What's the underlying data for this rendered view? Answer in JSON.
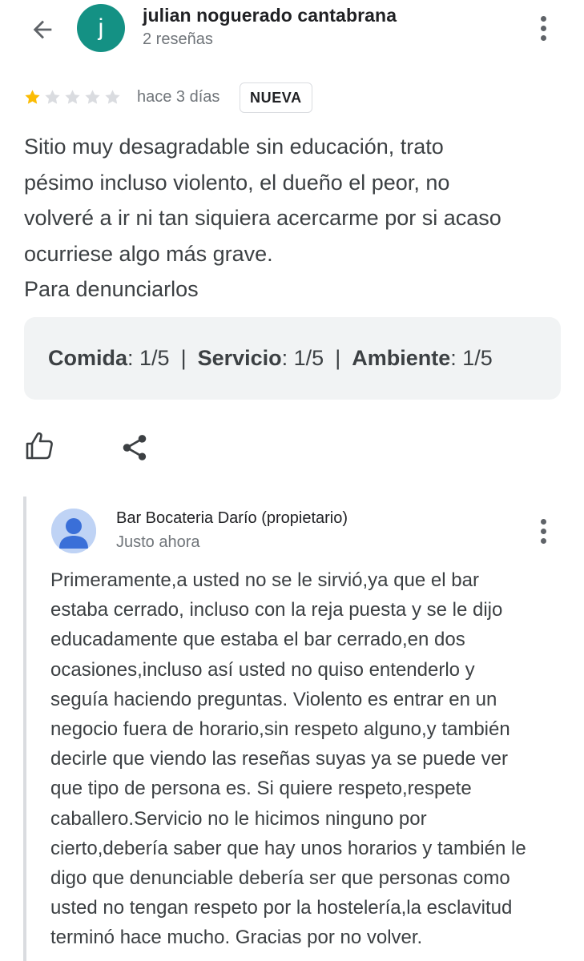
{
  "reviewer": {
    "avatar_letter": "j",
    "avatar_color": "#149184",
    "name": "julian noguerado cantabrana",
    "review_count": "2 reseñas"
  },
  "review": {
    "rating": 1,
    "rating_max": 5,
    "time": "hace 3 días",
    "badge": "NUEVA",
    "text": "Sitio muy desagradable sin educación, trato\npésimo incluso violento, el dueño el peor, no\nvolveré a ir ni tan siquiera acercarme por si acaso\nocurriese algo más grave.\nPara denunciarlos",
    "sub_ratings": [
      {
        "label": "Comida",
        "value": ": 1/5"
      },
      {
        "label": "Servicio",
        "value": ": 1/5"
      },
      {
        "label": "Ambiente",
        "value": ": 1/5"
      }
    ],
    "separator": "|"
  },
  "actions": {
    "like_icon": "thumbs-up-icon",
    "share_icon": "share-icon"
  },
  "owner_response": {
    "name": "Bar Bocateria Darío (propietario)",
    "time": "Justo ahora",
    "text": "Primeramente,a usted no se le sirvió,ya que el bar\nestaba cerrado, incluso con la reja puesta y se le dijo\neducadamente que estaba el bar cerrado,en dos\nocasiones,incluso así usted no quiso entenderlo y\nseguía haciendo preguntas. Violento es entrar en un\nnegocio fuera de horario,sin respeto alguno,y también\ndecirle que viendo las reseñas suyas ya se puede ver\nque tipo de persona es. Si quiere respeto,respete\ncaballero.Servicio no le hicimos ninguno por\ncierto,debería saber que hay unos horarios y también le\ndigo que denunciable debería ser que personas como\nusted no tengan respeto por la hostelería,la esclavitud\nterminó hace mucho. Gracias por no volver."
  },
  "colors": {
    "star_filled": "#fbbc04",
    "star_empty": "#dadce0",
    "ratings_box_bg": "#f1f3f4",
    "secondary_text": "#70757a"
  }
}
